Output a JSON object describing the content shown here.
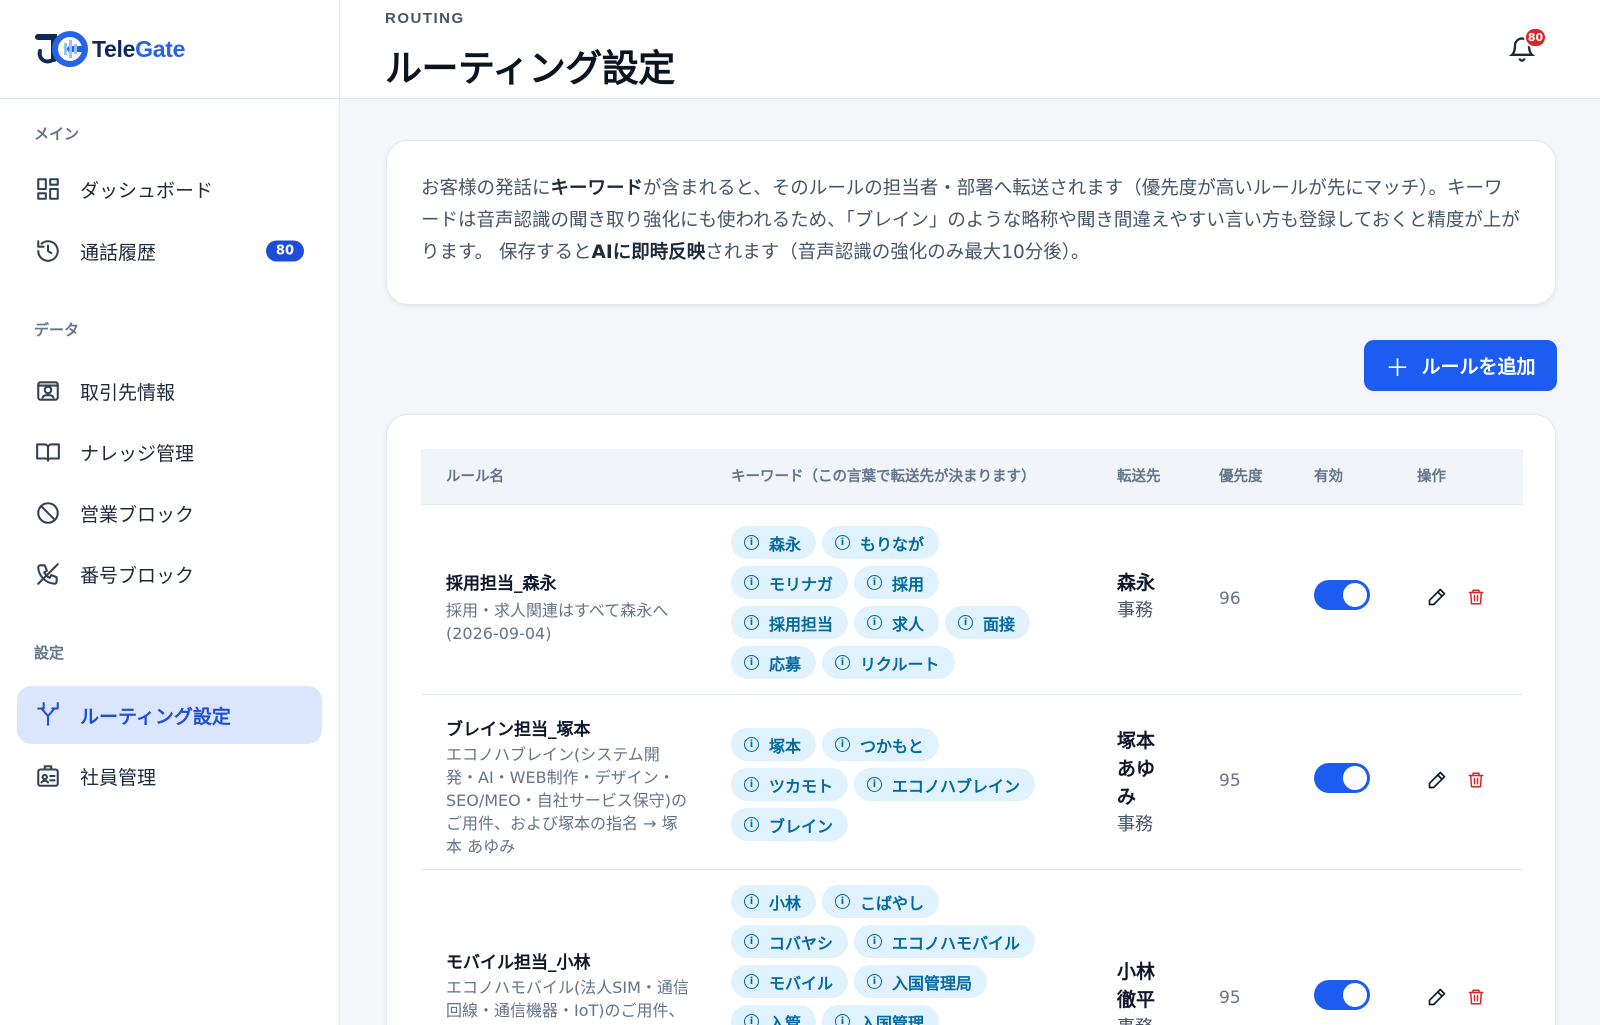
{
  "app": {
    "logo_tele": "Tele",
    "logo_gate": "Gate"
  },
  "header": {
    "eyebrow": "ROUTING",
    "title": "ルーティング設定",
    "notification_count": "80"
  },
  "sidebar": {
    "sections": [
      {
        "label": "メイン",
        "items": [
          {
            "label": "ダッシュボード",
            "icon": "dashboard-icon"
          },
          {
            "label": "通話履歴",
            "icon": "history-icon",
            "badge": "80"
          }
        ]
      },
      {
        "label": "データ",
        "items": [
          {
            "label": "取引先情報",
            "icon": "contact-card-icon"
          },
          {
            "label": "ナレッジ管理",
            "icon": "book-icon"
          },
          {
            "label": "営業ブロック",
            "icon": "ban-icon"
          },
          {
            "label": "番号ブロック",
            "icon": "phone-off-icon"
          }
        ]
      },
      {
        "label": "設定",
        "items": [
          {
            "label": "ルーティング設定",
            "icon": "route-icon",
            "active": true
          },
          {
            "label": "社員管理",
            "icon": "id-badge-icon"
          }
        ]
      }
    ]
  },
  "info": {
    "t1": "お客様の発話に",
    "b1": "キーワード",
    "t2": "が含まれると、そのルールの担当者・部署へ転送されます（優先度が高いルールが先にマッチ）。キーワードは音声認識の聞き取り強化にも使われるため、「ブレイン」のような略称や聞き間違えやすい言い方も登録しておくと精度が上がります。 保存すると",
    "b2": "AIに即時反映",
    "t3": "されます（音声認識の強化のみ最大10分後）。"
  },
  "actions": {
    "add_rule_label": "ルールを追加"
  },
  "table": {
    "headers": {
      "name": "ルール名",
      "keywords": "キーワード（この言葉で転送先が決まります）",
      "destination": "転送先",
      "priority": "優先度",
      "enabled": "有効",
      "actions": "操作"
    },
    "rows": [
      {
        "name": "採用担当_森永",
        "desc": "採用・求人関連はすべて森永へ(2026-09-04)",
        "keywords": [
          "森永",
          "もりなが",
          "モリナガ",
          "採用",
          "採用担当",
          "求人",
          "面接",
          "応募",
          "リクルート"
        ],
        "dest_name": "森永",
        "dest_dept": "事務",
        "priority": "96",
        "enabled": true
      },
      {
        "name": "ブレイン担当_塚本",
        "desc": "エコノハブレイン(システム開発・AI・WEB制作・デザイン・SEO/MEO・自社サービス保守)のご用件、および塚本の指名 → 塚本 あゆみ",
        "keywords": [
          "塚本",
          "つかもと",
          "ツカモト",
          "エコノハブレイン",
          "ブレイン"
        ],
        "dest_name": "塚本あゆみ",
        "dest_dept": "事務",
        "priority": "95",
        "enabled": true
      },
      {
        "name": "モバイル担当_小林",
        "desc": "エコノハモバイル(法人SIM・通信回線・通信機器・IoT)のご用件、および小林の指名 → 小",
        "keywords": [
          "小林",
          "こばやし",
          "コバヤシ",
          "エコノハモバイル",
          "モバイル",
          "入国管理局",
          "入管",
          "入国管理"
        ],
        "dest_name": "小林徹平",
        "dest_dept": "事務",
        "priority": "95",
        "enabled": true
      }
    ]
  }
}
